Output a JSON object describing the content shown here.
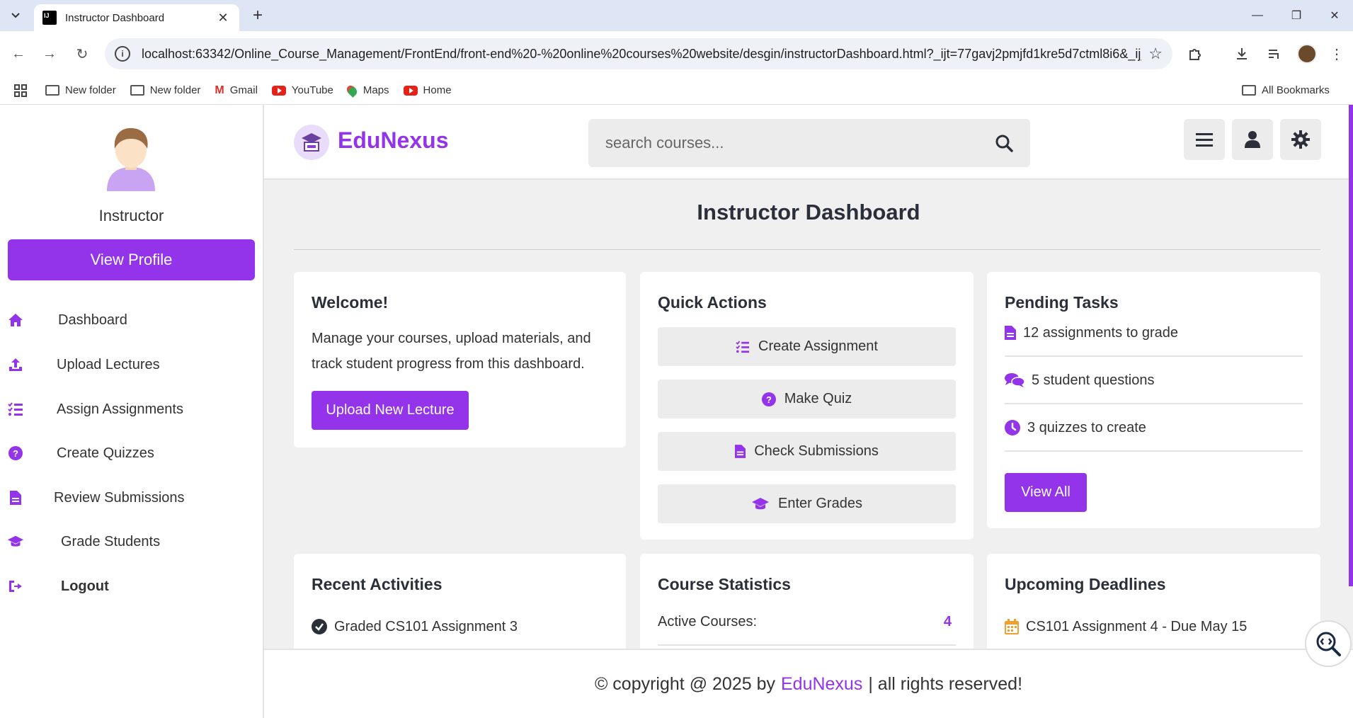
{
  "browser": {
    "tab_title": "Instructor Dashboard",
    "url": "localhost:63342/Online_Course_Management/FrontEnd/front-end%20-%20online%20courses%20website/desgin/instructorDashboard.html?_ijt=77gavj2pmjfd1kre5d7ctml8i6&_ij_re...",
    "bookmarks": [
      "New folder",
      "New folder",
      "Gmail",
      "YouTube",
      "Maps",
      "Home"
    ],
    "all_bookmarks": "All Bookmarks"
  },
  "sidebar": {
    "role": "Instructor",
    "view_profile": "View Profile",
    "items": [
      {
        "label": "Dashboard",
        "icon": "home-icon"
      },
      {
        "label": "Upload Lectures",
        "icon": "upload-icon"
      },
      {
        "label": "Assign Assignments",
        "icon": "list-icon"
      },
      {
        "label": "Create Quizzes",
        "icon": "question-icon"
      },
      {
        "label": "Review Submissions",
        "icon": "file-icon"
      },
      {
        "label": "Grade Students",
        "icon": "graduation-cap-icon"
      },
      {
        "label": "Logout",
        "icon": "logout-icon"
      }
    ]
  },
  "header": {
    "brand": "EduNexus",
    "search_placeholder": "search courses..."
  },
  "page": {
    "title": "Instructor Dashboard"
  },
  "welcome": {
    "title": "Welcome!",
    "text_line1": "Manage your courses, upload materials, and",
    "text_line2": "track student progress from this dashboard.",
    "button": "Upload New Lecture"
  },
  "quick_actions": {
    "title": "Quick Actions",
    "buttons": [
      "Create Assignment",
      "Make Quiz",
      "Check Submissions",
      "Enter Grades"
    ]
  },
  "pending_tasks": {
    "title": "Pending Tasks",
    "items": [
      "12 assignments to grade",
      "5 student questions",
      "3 quizzes to create"
    ],
    "button": "View All"
  },
  "recent_activities": {
    "title": "Recent Activities",
    "items": [
      "Graded CS101 Assignment 3"
    ]
  },
  "course_statistics": {
    "title": "Course Statistics",
    "label": "Active Courses:",
    "value": "4"
  },
  "upcoming_deadlines": {
    "title": "Upcoming Deadlines",
    "items": [
      "CS101 Assignment 4 - Due May 15"
    ]
  },
  "footer": {
    "prefix": "© copyright @ 2025 by",
    "brand": "EduNexus",
    "suffix": "| all rights reserved!"
  },
  "colors": {
    "accent": "#9333ea",
    "panel_bg": "#f0f0f0",
    "text": "#2b2f3a"
  }
}
